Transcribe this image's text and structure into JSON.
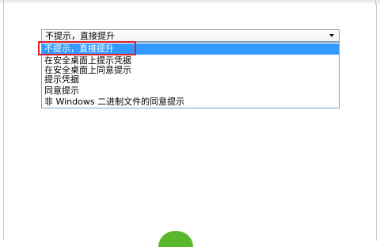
{
  "dropdown": {
    "selected_value": "不提示，直接提升",
    "options": [
      "不提示，直接提升",
      "在安全桌面上提示凭据",
      "在安全桌面上同意提示",
      "提示凭据",
      "同意提示",
      "非 Windows 二进制文件的同意提示"
    ]
  },
  "colors": {
    "selection": "#3399ff",
    "highlight_frame": "#d92026",
    "accent_green": "#5ab72c"
  },
  "icons": {
    "combo_arrow": "chevron-down-icon"
  }
}
